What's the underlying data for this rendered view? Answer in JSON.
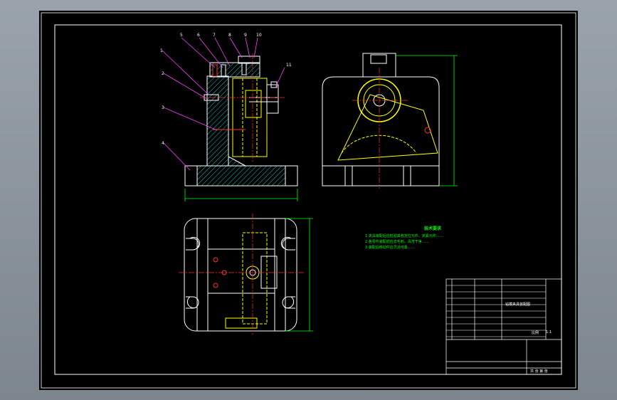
{
  "balloons": [
    "1",
    "2",
    "3",
    "4",
    "5",
    "6",
    "7",
    "8",
    "9",
    "10",
    "11"
  ],
  "notes": {
    "title": "技术要求",
    "lines": [
      "1.夹具装配后应检验其各定位元件、夹紧元件……",
      "2.各零件装配前应去毛刺，清洗干净……",
      "3.装配后移动件应灵活可靠……"
    ]
  },
  "title_block": {
    "part_title": "钻模夹具装配图",
    "scale_label": "比例",
    "scale_value": "1:1",
    "sheet_label": "共 张 第 张"
  },
  "colors": {
    "frame": "#ffffff",
    "part": "#ffffff",
    "hatch": "#00c8c8",
    "center_line": "#ff3030",
    "hidden": "#ffff00",
    "dimension": "#00ff00",
    "leader": "#ff40ff"
  }
}
